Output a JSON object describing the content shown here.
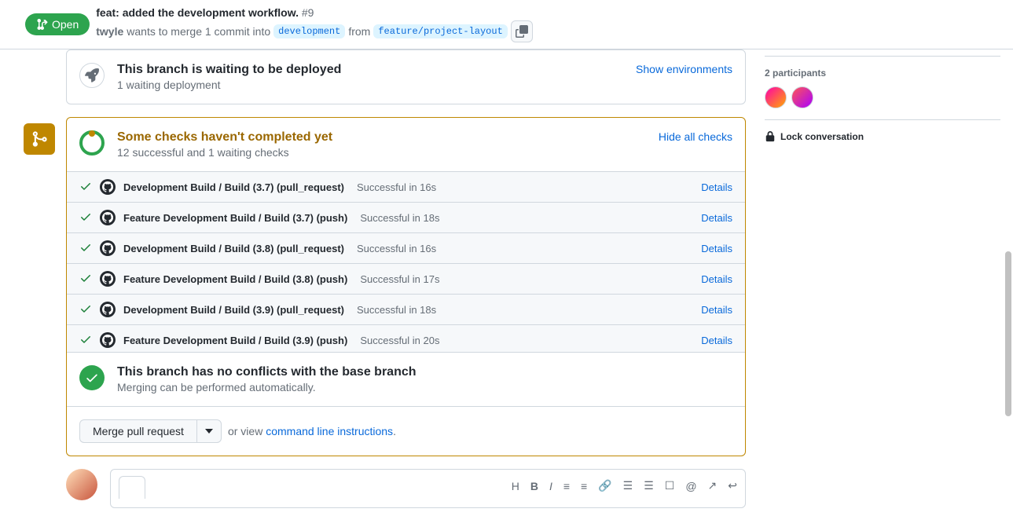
{
  "header": {
    "state": "Open",
    "title": "feat: added the development workflow.",
    "number": "#9",
    "author": "twyle",
    "wants_text": "wants to merge 1 commit into",
    "base_branch": "development",
    "from_text": "from",
    "head_branch": "feature/project-layout"
  },
  "deploy": {
    "title": "This branch is waiting to be deployed",
    "sub": "1 waiting deployment",
    "link": "Show environments"
  },
  "checks": {
    "title": "Some checks haven't completed yet",
    "sub": "12 successful and 1 waiting checks",
    "hide_link": "Hide all checks",
    "rows": [
      {
        "name": "Development Build / Build (3.7) (pull_request)",
        "result": "Successful in 16s",
        "details": "Details"
      },
      {
        "name": "Feature Development Build / Build (3.7) (push)",
        "result": "Successful in 18s",
        "details": "Details"
      },
      {
        "name": "Development Build / Build (3.8) (pull_request)",
        "result": "Successful in 16s",
        "details": "Details"
      },
      {
        "name": "Feature Development Build / Build (3.8) (push)",
        "result": "Successful in 17s",
        "details": "Details"
      },
      {
        "name": "Development Build / Build (3.9) (pull_request)",
        "result": "Successful in 18s",
        "details": "Details"
      },
      {
        "name": "Feature Development Build / Build (3.9) (push)",
        "result": "Successful in 20s",
        "details": "Details"
      }
    ]
  },
  "conflict": {
    "title": "This branch has no conflicts with the base branch",
    "sub": "Merging can be performed automatically."
  },
  "merge": {
    "button": "Merge pull request",
    "or_text": "or view",
    "cli_link": "command line instructions"
  },
  "sidebar": {
    "participants_label": "2 participants",
    "lock_label": "Lock conversation"
  }
}
